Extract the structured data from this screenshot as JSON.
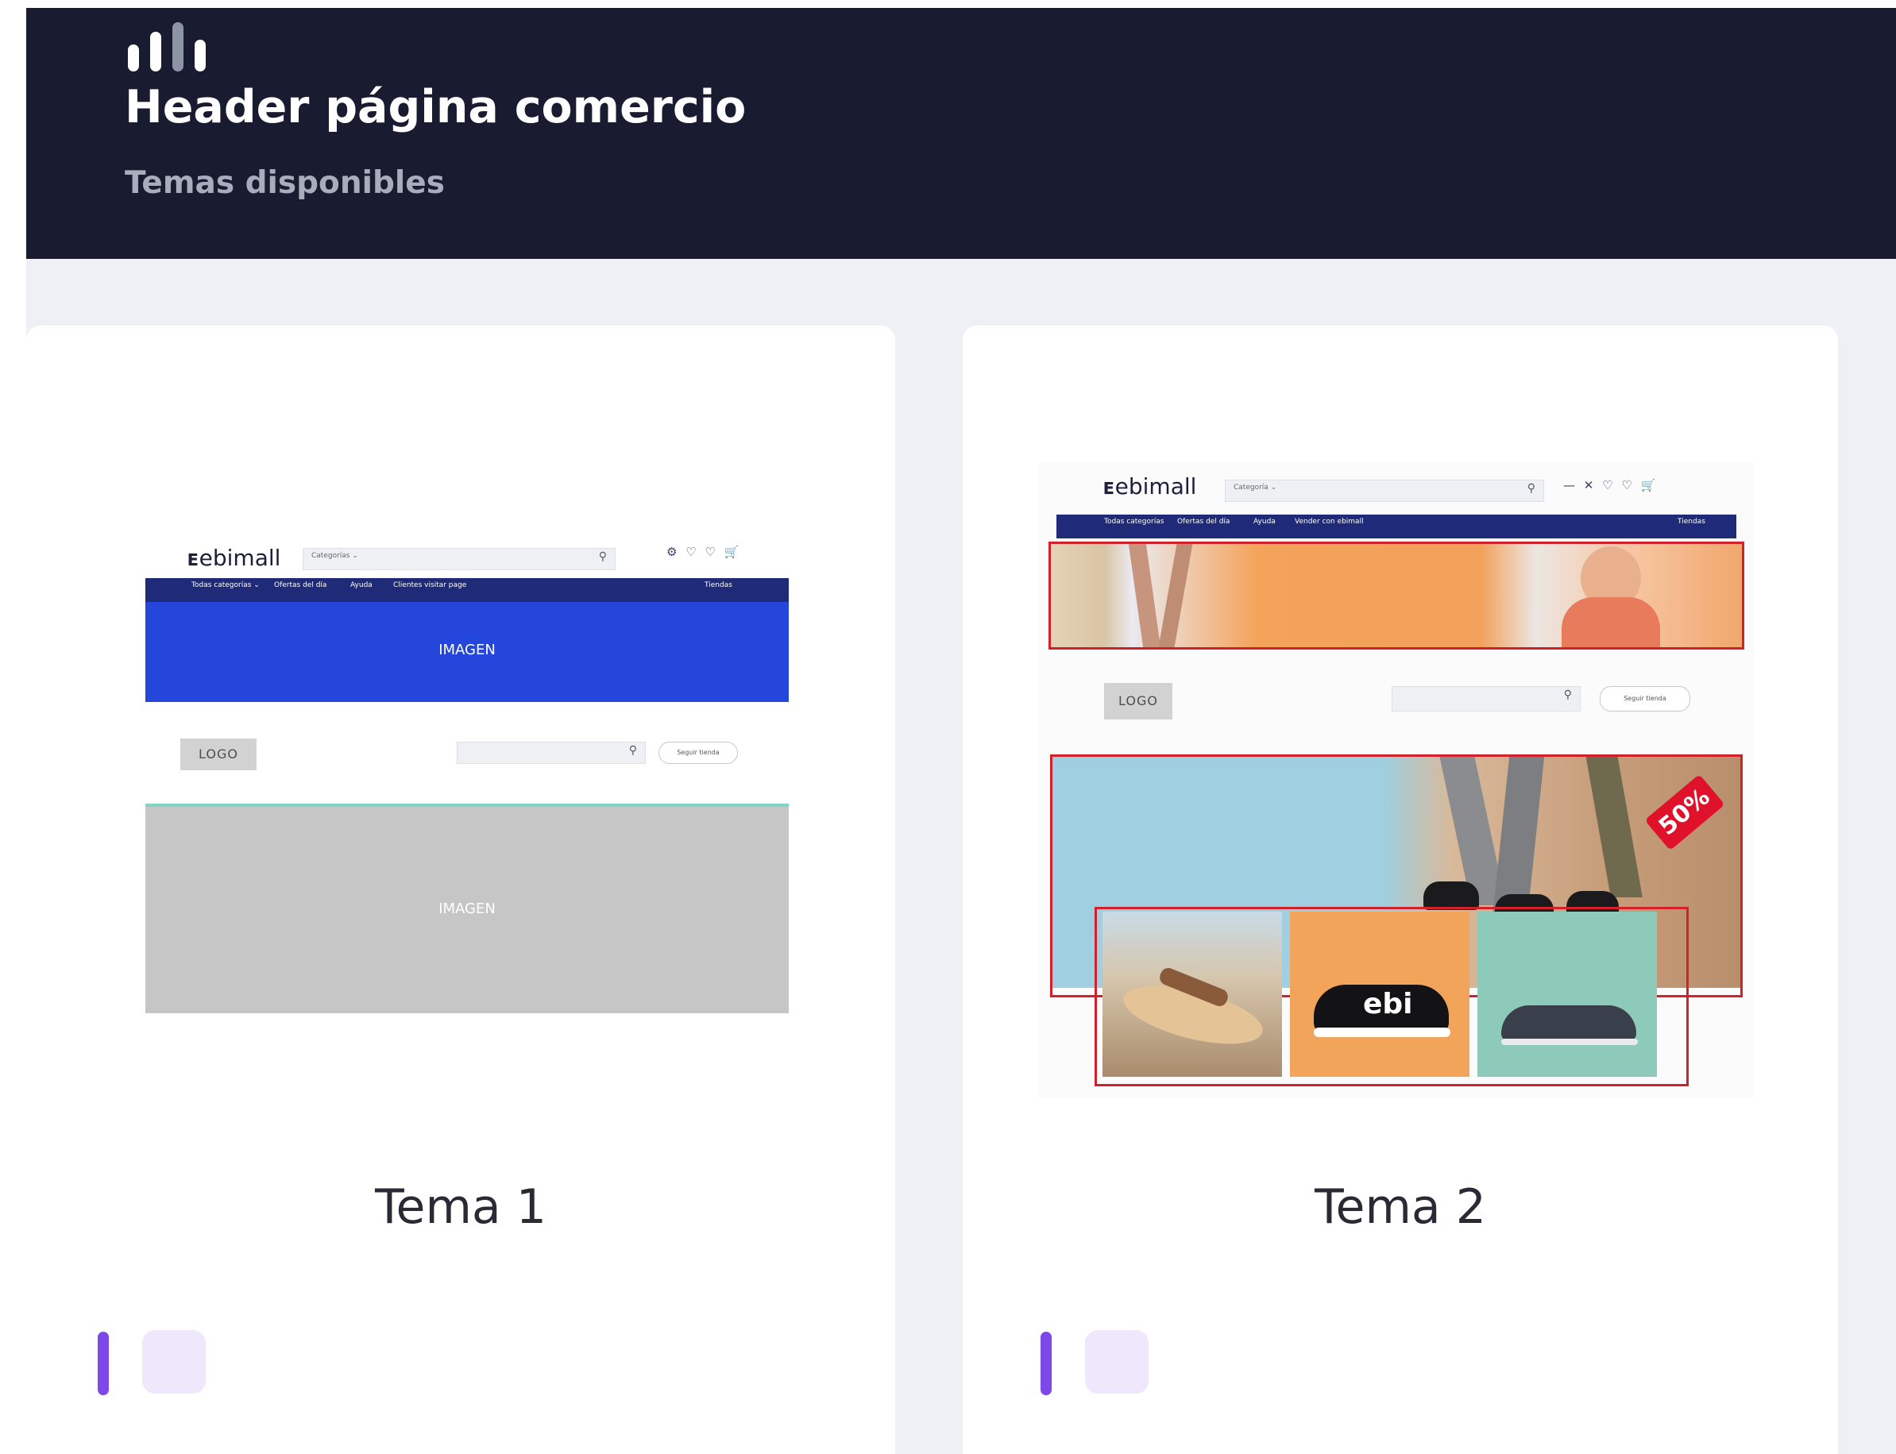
{
  "header": {
    "title": "Header página comercio",
    "subtitle": "Temas disponibles"
  },
  "themes": [
    {
      "name": "Tema 1",
      "preview": {
        "brand": "ebimall",
        "search_category": "Categorías ⌄",
        "nav_items": [
          "Todas categorías ⌄",
          "Ofertas del día",
          "Ayuda",
          "Clientes visitar page"
        ],
        "nav_right": "Tiendas",
        "banner_top_label": "IMAGEN",
        "logo_label": "LOGO",
        "follow_label": "Seguir tienda",
        "banner_bottom_label": "IMAGEN"
      }
    },
    {
      "name": "Tema 2",
      "preview": {
        "brand": "ebimall",
        "search_category": "Categoría ⌄",
        "nav_items": [
          "Todas categorías",
          "Ofertas del día",
          "Ayuda",
          "Vender con ebimall"
        ],
        "nav_right": "Tiendas",
        "logo_label": "LOGO",
        "follow_label": "Seguir tienda",
        "sale_badge": "50%",
        "product_brand": "ebi"
      }
    }
  ],
  "colors": {
    "header_bg": "#191b31",
    "page_bg": "#eef0f5",
    "accent": "#7e47e8",
    "chip_bg": "#efe8fd"
  },
  "icons": [
    "bar-chart-logo-icon",
    "search-icon",
    "cart-icon",
    "heart-icon",
    "user-icon"
  ]
}
